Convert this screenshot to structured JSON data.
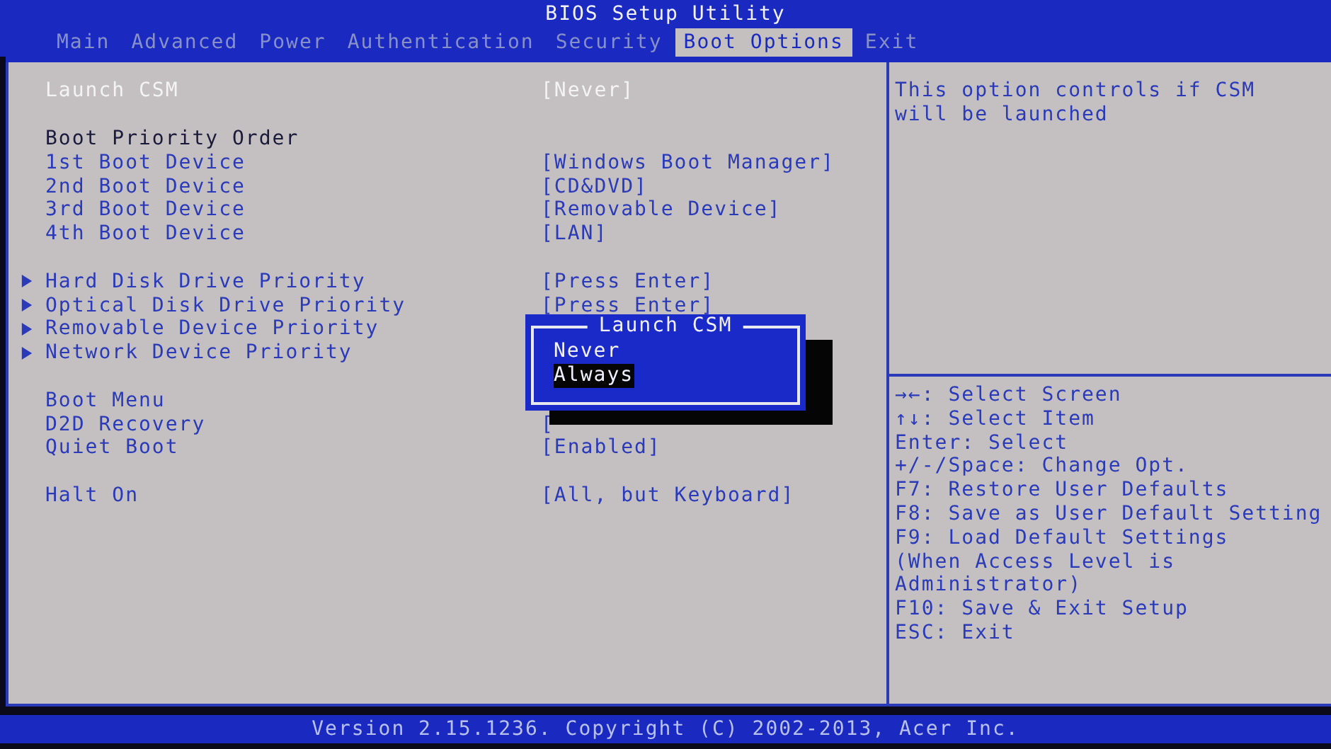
{
  "window": {
    "title": "BIOS Setup Utility"
  },
  "tabs": [
    {
      "label": "Main",
      "selected": false
    },
    {
      "label": "Advanced",
      "selected": false
    },
    {
      "label": "Power",
      "selected": false
    },
    {
      "label": "Authentication",
      "selected": false
    },
    {
      "label": "Security",
      "selected": false
    },
    {
      "label": "Boot Options",
      "selected": true
    },
    {
      "label": "Exit",
      "selected": false
    }
  ],
  "sections": [
    {
      "items": [
        {
          "kind": "setting",
          "label": "Launch CSM",
          "value": "[Never]",
          "selected": true
        }
      ]
    },
    {
      "items": [
        {
          "kind": "heading",
          "label": "Boot Priority Order"
        },
        {
          "kind": "setting",
          "label": "1st Boot Device",
          "value": "[Windows Boot Manager]",
          "selected": false
        },
        {
          "kind": "setting",
          "label": "2nd Boot Device",
          "value": "[CD&DVD]",
          "selected": false
        },
        {
          "kind": "setting",
          "label": "3rd Boot Device",
          "value": "[Removable Device]",
          "selected": false
        },
        {
          "kind": "setting",
          "label": "4th Boot Device",
          "value": "[LAN]",
          "selected": false
        }
      ]
    },
    {
      "items": [
        {
          "kind": "submenu",
          "label": "Hard Disk Drive Priority",
          "value": "[Press Enter]",
          "selected": false
        },
        {
          "kind": "submenu",
          "label": "Optical Disk Drive Priority",
          "value": "[Press Enter]",
          "selected": false
        },
        {
          "kind": "submenu",
          "label": "Removable Device Priority",
          "selected": false
        },
        {
          "kind": "submenu",
          "label": "Network Device Priority",
          "selected": false
        }
      ]
    },
    {
      "items": [
        {
          "kind": "setting",
          "label": "Boot Menu",
          "selected": false
        },
        {
          "kind": "setting",
          "label": "D2D Recovery",
          "value": "[",
          "selected": false
        },
        {
          "kind": "setting",
          "label": "Quiet Boot",
          "value": "[Enabled]",
          "selected": false
        }
      ]
    },
    {
      "items": [
        {
          "kind": "setting",
          "label": "Halt On",
          "value": "[All, but Keyboard]",
          "selected": false
        }
      ]
    }
  ],
  "popup": {
    "title": "Launch CSM",
    "options": [
      {
        "label": "Never",
        "selected": false
      },
      {
        "label": "Always",
        "selected": true
      }
    ]
  },
  "help": "This option controls if CSM will be launched",
  "keys": [
    "→←: Select Screen",
    "↑↓: Select Item",
    "Enter: Select",
    "+/-/Space: Change Opt.",
    "F7: Restore User Defaults",
    "F8: Save as User Default Setting",
    "F9: Load Default Settings",
    "(When Access Level is",
    "Administrator)",
    "F10: Save & Exit Setup",
    "ESC: Exit"
  ],
  "status_bar": "Version 2.15.1236. Copyright (C) 2002-2013, Acer Inc."
}
